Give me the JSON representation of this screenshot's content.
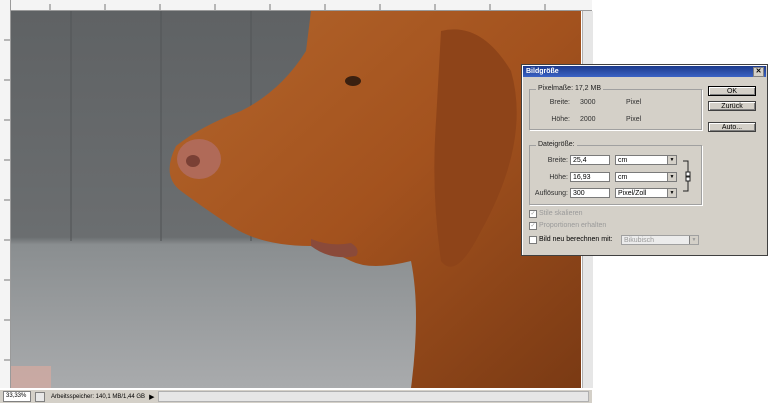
{
  "statusbar": {
    "zoom": "33,33%",
    "doc_info": "Arbeitsspeicher: 140,1 MB/1,44 GB"
  },
  "dialog": {
    "title": "Bildgröße",
    "close_glyph": "✕",
    "pixel_group": {
      "legend": "Pixelmaße: 17,2 MB",
      "width_label": "Breite:",
      "width_value": "3000",
      "width_unit": "Pixel",
      "height_label": "Höhe:",
      "height_value": "2000",
      "height_unit": "Pixel"
    },
    "doc_group": {
      "legend": "Dateigröße:",
      "width_label": "Breite:",
      "width_value": "25,4",
      "width_unit": "cm",
      "height_label": "Höhe:",
      "height_value": "16,93",
      "height_unit": "cm",
      "res_label": "Auflösung:",
      "res_value": "300",
      "res_unit": "Pixel/Zoll"
    },
    "buttons": {
      "ok": "OK",
      "reset": "Zurück",
      "auto": "Auto..."
    },
    "options": {
      "scale_styles": "Stile skalieren",
      "constrain": "Proportionen erhalten",
      "resample": "Bild neu berechnen mit:",
      "resample_method": "Bikubisch"
    }
  },
  "colors": {
    "title_bar": "#1c3a8c",
    "dialog_bg": "#d4d0c8"
  }
}
